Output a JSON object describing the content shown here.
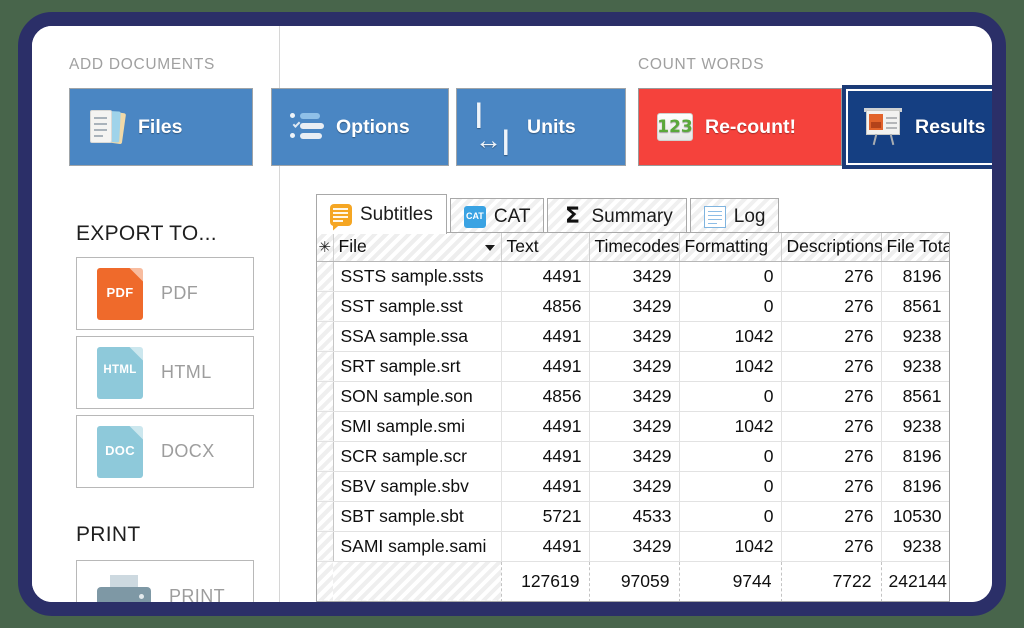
{
  "ribbon": {
    "groups": [
      {
        "label": "ADD DOCUMENTS"
      },
      {
        "label": "COUNT WORDS"
      }
    ],
    "buttons": [
      {
        "label": "Files",
        "icon": "files-icon",
        "style": "blue"
      },
      {
        "label": "Options",
        "icon": "options-icon",
        "style": "blue"
      },
      {
        "label": "Units",
        "icon": "units-icon",
        "style": "blue"
      },
      {
        "label": "Re-count!",
        "icon": "numbers-icon",
        "style": "red"
      },
      {
        "label": "Results",
        "icon": "results-icon",
        "style": "active"
      }
    ]
  },
  "sidebar": {
    "export_heading": "EXPORT TO...",
    "export_items": [
      {
        "label": "PDF",
        "icon": "pdf-file-icon",
        "tag": "PDF",
        "color": "#ef6a2b"
      },
      {
        "label": "HTML",
        "icon": "html-file-icon",
        "tag": "HTML",
        "color": "#8ec9da"
      },
      {
        "label": "DOCX",
        "icon": "doc-file-icon",
        "tag": "DOC",
        "color": "#8ec9da"
      }
    ],
    "print_heading": "PRINT",
    "print_items": [
      {
        "label": "PRINT",
        "icon": "printer-icon"
      }
    ]
  },
  "tabs": [
    {
      "label": "Subtitles",
      "icon": "speech-bubble-icon",
      "selected": true
    },
    {
      "label": "CAT",
      "icon": "cat-file-icon",
      "selected": false
    },
    {
      "label": "Summary",
      "icon": "sigma-icon",
      "selected": false
    },
    {
      "label": "Log",
      "icon": "log-document-icon",
      "selected": false
    }
  ],
  "grid": {
    "row_selector_glyph": "✳",
    "columns": [
      "File",
      "Text",
      "Timecodes",
      "Formatting",
      "Descriptions",
      "File Total"
    ],
    "sorted_column": "File",
    "rows": [
      {
        "file": "SSTS sample.ssts",
        "text": "4491",
        "timecodes": "3429",
        "formatting": "0",
        "descriptions": "276",
        "file_total": "8196"
      },
      {
        "file": "SST sample.sst",
        "text": "4856",
        "timecodes": "3429",
        "formatting": "0",
        "descriptions": "276",
        "file_total": "8561"
      },
      {
        "file": "SSA sample.ssa",
        "text": "4491",
        "timecodes": "3429",
        "formatting": "1042",
        "descriptions": "276",
        "file_total": "9238"
      },
      {
        "file": "SRT sample.srt",
        "text": "4491",
        "timecodes": "3429",
        "formatting": "1042",
        "descriptions": "276",
        "file_total": "9238"
      },
      {
        "file": "SON sample.son",
        "text": "4856",
        "timecodes": "3429",
        "formatting": "0",
        "descriptions": "276",
        "file_total": "8561"
      },
      {
        "file": "SMI sample.smi",
        "text": "4491",
        "timecodes": "3429",
        "formatting": "1042",
        "descriptions": "276",
        "file_total": "9238"
      },
      {
        "file": "SCR sample.scr",
        "text": "4491",
        "timecodes": "3429",
        "formatting": "0",
        "descriptions": "276",
        "file_total": "8196"
      },
      {
        "file": "SBV sample.sbv",
        "text": "4491",
        "timecodes": "3429",
        "formatting": "0",
        "descriptions": "276",
        "file_total": "8196"
      },
      {
        "file": "SBT sample.sbt",
        "text": "5721",
        "timecodes": "4533",
        "formatting": "0",
        "descriptions": "276",
        "file_total": "10530"
      },
      {
        "file": "SAMI sample.sami",
        "text": "4491",
        "timecodes": "3429",
        "formatting": "1042",
        "descriptions": "276",
        "file_total": "9238"
      }
    ],
    "totals": {
      "file": "",
      "text": "127619",
      "timecodes": "97059",
      "formatting": "9744",
      "descriptions": "7722",
      "file_total": "242144"
    }
  },
  "theme": {
    "frame": "#2b2f68",
    "page_bg": "#48654b",
    "ribbon_blue": "#4a86c3",
    "ribbon_red": "#f5423c",
    "ribbon_active": "#153f82"
  }
}
